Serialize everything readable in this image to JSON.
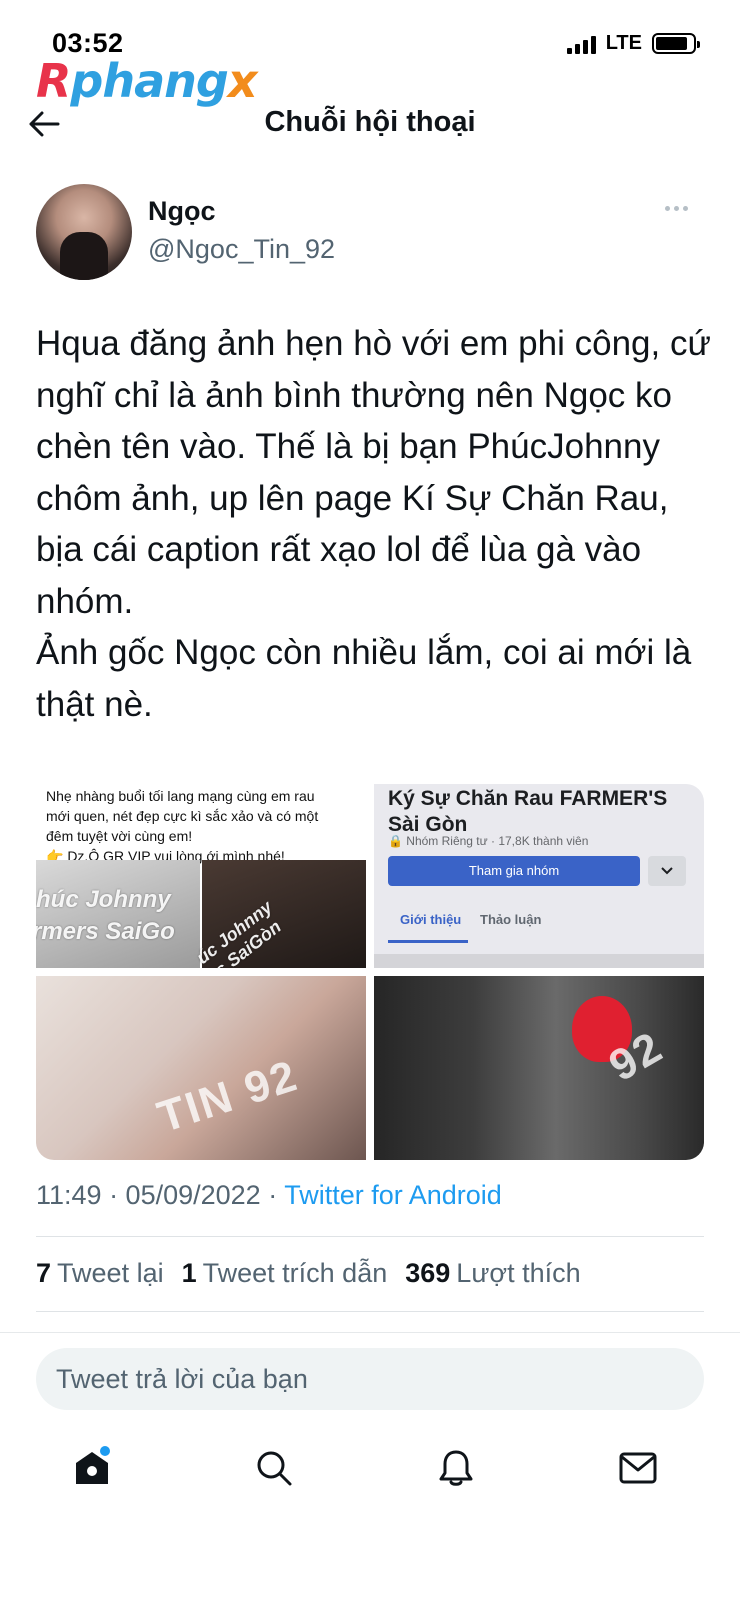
{
  "status_bar": {
    "time": "03:52",
    "network": "LTE"
  },
  "watermark": {
    "part1": "R",
    "part2": "phang",
    "part3": "x"
  },
  "header": {
    "title": "Chuỗi hội thoại",
    "back_icon": "arrow-left-icon"
  },
  "tweet": {
    "author_name": "Ngọc",
    "author_handle": "@Ngoc_Tin_92",
    "text": "Hqua đăng ảnh hẹn hò với em phi công, cứ nghĩ chỉ là ảnh bình thường nên Ngọc ko chèn tên vào. Thế là bị bạn PhúcJohnny chôm ảnh, up lên page Kí Sự Chăn Rau, bịa cái caption rất xạo lol để lùa gà vào nhóm.\nẢnh gốc Ngọc còn nhiều lắm, coi ai mới là thật nè.",
    "time": "11:49 · 05/09/2022 · ",
    "source": "Twitter for Android",
    "stats": {
      "retweets_count": "7",
      "retweets_label": "Tweet lại",
      "quotes_count": "1",
      "quotes_label": "Tweet trích dẫn",
      "likes_count": "369",
      "likes_label": "Lượt thích"
    }
  },
  "media": {
    "tile1": {
      "post_text": "Nhẹ nhàng buổi tối lang mạng cùng em rau\nmới quen, nét đẹp cực kì sắc xảo và có một\nđêm tuyệt vời cùng em!\n👉 Dz.Ô  GR VIP vui lòng ới mình nhé!",
      "wm_line1": "húc Johnny",
      "wm_line2": "rmers SaiGo",
      "wm_right": "úc Johnny\nrs SaiGòn"
    },
    "tile2": {
      "group_title": "Ký Sự Chăn Rau FARMER'S\nSài Gòn",
      "group_meta": "🔒 Nhóm Riêng tư · 17,8K thành viên",
      "join_button": "Tham gia nhóm",
      "tab_about": "Giới thiệu",
      "tab_discuss": "Thảo luận"
    },
    "tile3": {
      "watermark": "TIN 92"
    },
    "tile4": {
      "watermark": "92"
    }
  },
  "reply": {
    "placeholder": "Tweet trả lời của bạn"
  },
  "nav": {
    "items": [
      "home-icon",
      "search-icon",
      "bell-icon",
      "mail-icon"
    ]
  }
}
